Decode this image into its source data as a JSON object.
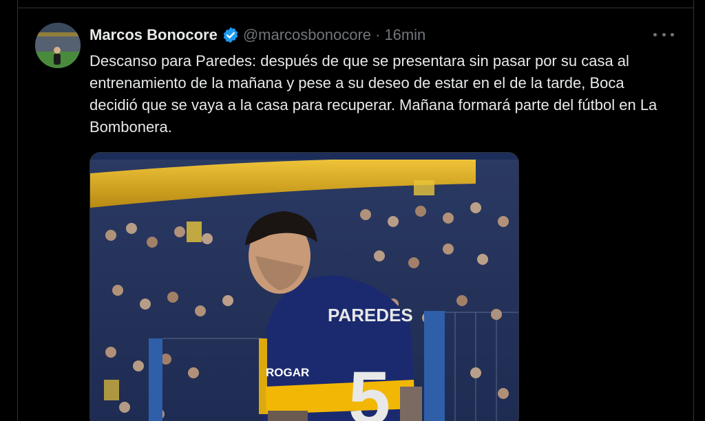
{
  "tweet": {
    "author": {
      "display_name": "Marcos Bonocore",
      "handle": "@marcosbonocore",
      "verified_icon": "verified-badge-icon",
      "avatar_icon": "user-avatar"
    },
    "separator": "·",
    "timestamp": "16min",
    "more_icon": "more-options-icon",
    "text": "Descanso para Paredes: después de que se presentara sin pasar por su casa al entrenamiento de la mañana y pese a su deseo de estar en el de la tarde, Boca decidió que se vaya a la casa para recuperar. Mañana formará parte del fútbol en La Bombonera.",
    "media": {
      "jersey_name": "PAREDES",
      "jersey_number": "5",
      "sponsor": "ROGAR",
      "image_icon": "player-photo"
    }
  },
  "colors": {
    "background": "#000000",
    "text_primary": "#e7e9ea",
    "text_secondary": "#71767b",
    "divider": "#2f3336",
    "verified_blue": "#1d9bf0",
    "boca_blue": "#1a2a6c",
    "boca_gold": "#f2b705"
  }
}
